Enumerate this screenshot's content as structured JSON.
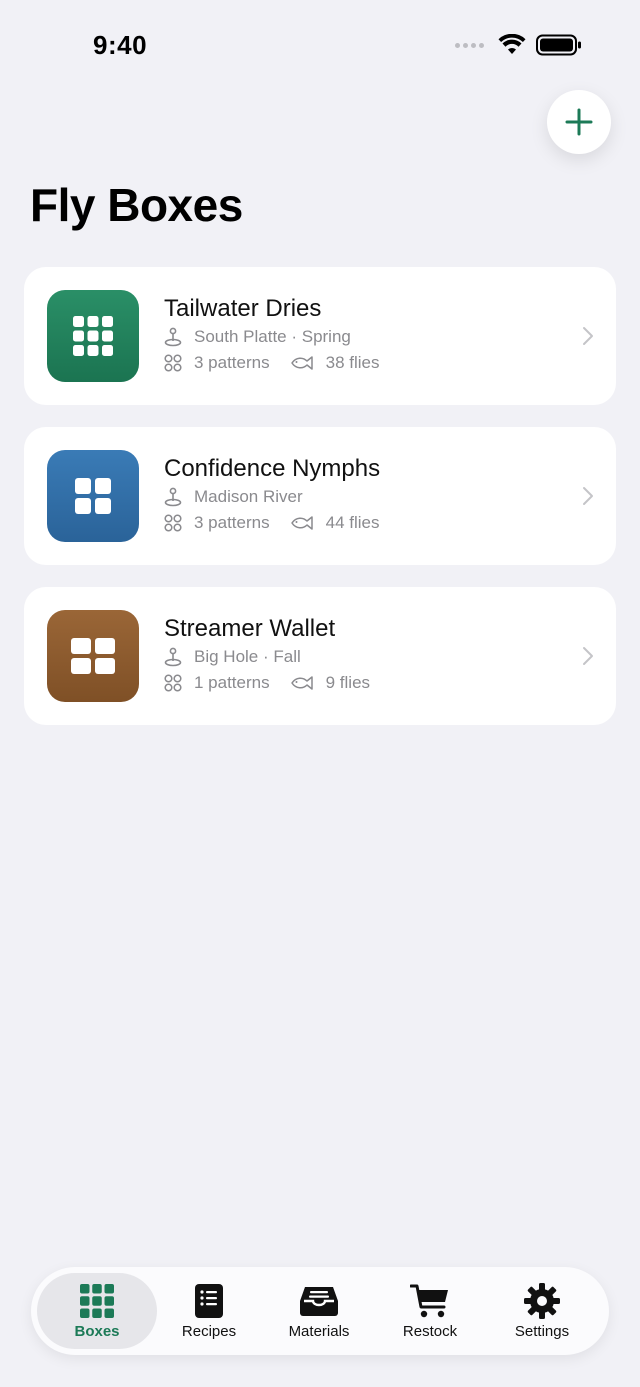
{
  "status_bar": {
    "time": "9:40"
  },
  "header": {
    "title": "Fly Boxes",
    "add_icon": "plus-icon"
  },
  "colors": {
    "accent": "#1c7a57",
    "green_box": "#1f7f5a",
    "blue_box": "#2f6ea8",
    "brown_box": "#8b5a2b"
  },
  "boxes": [
    {
      "title": "Tailwater Dries",
      "location": "South Platte · Spring",
      "patterns": "3 patterns",
      "flies": "38 flies",
      "icon": "grid-3x3-icon"
    },
    {
      "title": "Confidence Nymphs",
      "location": "Madison River",
      "patterns": "3 patterns",
      "flies": "44 flies",
      "icon": "grid-2x2-icon"
    },
    {
      "title": "Streamer Wallet",
      "location": "Big Hole · Fall",
      "patterns": "1 patterns",
      "flies": "9 flies",
      "icon": "grid-2x2-icon"
    }
  ],
  "tabs": [
    {
      "label": "Boxes",
      "icon": "grid-icon",
      "active": true
    },
    {
      "label": "Recipes",
      "icon": "book-list-icon",
      "active": false
    },
    {
      "label": "Materials",
      "icon": "tray-icon",
      "active": false
    },
    {
      "label": "Restock",
      "icon": "cart-icon",
      "active": false
    },
    {
      "label": "Settings",
      "icon": "gear-icon",
      "active": false
    }
  ]
}
